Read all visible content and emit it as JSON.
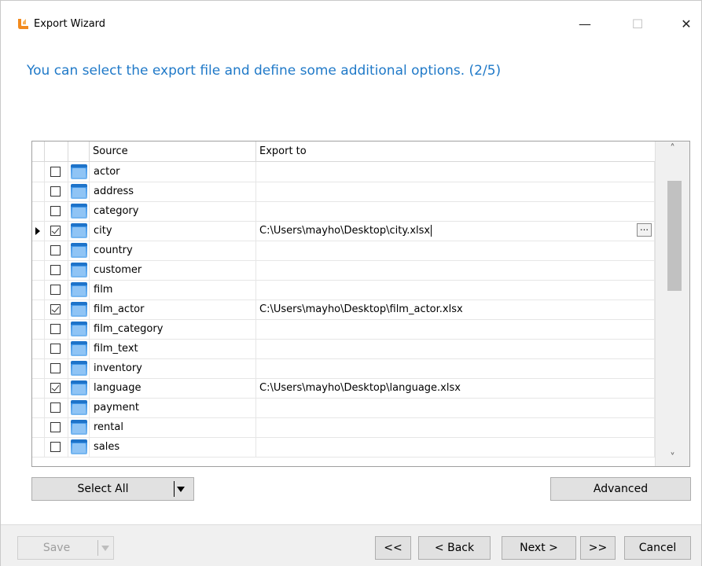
{
  "window": {
    "title": "Export Wizard",
    "minimize_glyph": "—",
    "maximize_glyph": "☐",
    "close_glyph": "✕",
    "icon": "app-logo-icon"
  },
  "heading": "You can select the export file and define some additional options. (2/5)",
  "grid": {
    "columns": {
      "source": "Source",
      "export_to": "Export to"
    },
    "rows": [
      {
        "source": "actor",
        "export_to": "",
        "checked": false
      },
      {
        "source": "address",
        "export_to": "",
        "checked": false
      },
      {
        "source": "category",
        "export_to": "",
        "checked": false
      },
      {
        "source": "city",
        "export_to": "C:\\Users\\mayho\\Desktop\\city.xlsx",
        "checked": true,
        "current": true
      },
      {
        "source": "country",
        "export_to": "",
        "checked": false
      },
      {
        "source": "customer",
        "export_to": "",
        "checked": false
      },
      {
        "source": "film",
        "export_to": "",
        "checked": false
      },
      {
        "source": "film_actor",
        "export_to": "C:\\Users\\mayho\\Desktop\\film_actor.xlsx",
        "checked": true
      },
      {
        "source": "film_category",
        "export_to": "",
        "checked": false
      },
      {
        "source": "film_text",
        "export_to": "",
        "checked": false
      },
      {
        "source": "inventory",
        "export_to": "",
        "checked": false
      },
      {
        "source": "language",
        "export_to": "C:\\Users\\mayho\\Desktop\\language.xlsx",
        "checked": true
      },
      {
        "source": "payment",
        "export_to": "",
        "checked": false
      },
      {
        "source": "rental",
        "export_to": "",
        "checked": false
      },
      {
        "source": "sales",
        "export_to": "",
        "checked": false
      }
    ],
    "browse_label": "…",
    "scroll_up": "˄",
    "scroll_down": "˅"
  },
  "buttons": {
    "select_all": "Select All",
    "advanced": "Advanced",
    "save": "Save",
    "first": "<<",
    "back": "< Back",
    "next": "Next >",
    "last": ">>",
    "cancel": "Cancel"
  },
  "colors": {
    "heading": "#1f79c8",
    "button_face": "#e1e1e1",
    "footer": "#f0f0f0"
  }
}
